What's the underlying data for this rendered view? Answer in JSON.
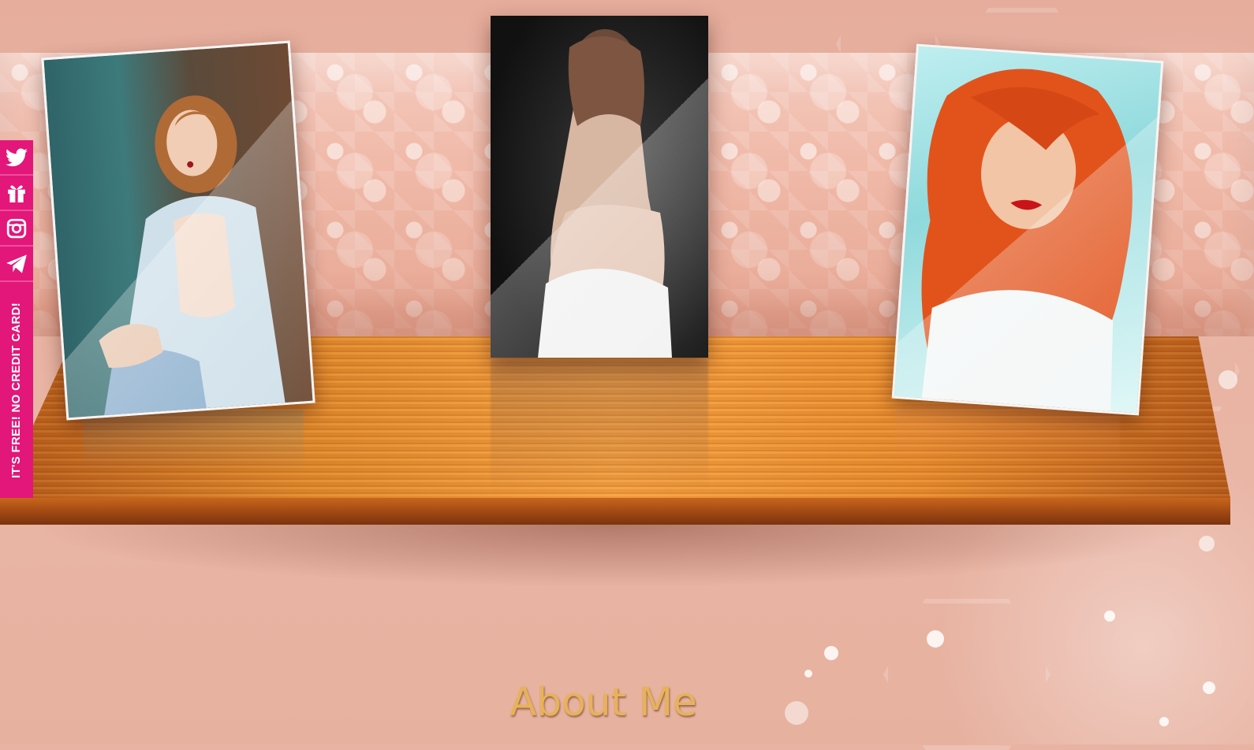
{
  "sidebar": {
    "icons": [
      {
        "name": "twitter-icon"
      },
      {
        "name": "gift-icon"
      },
      {
        "name": "instagram-icon"
      },
      {
        "name": "telegram-icon"
      }
    ],
    "promo_text": "IT'S FREE! NO CREDIT CARD!",
    "color": "#e3167a"
  },
  "gallery": {
    "photos": [
      {
        "name": "photo-left"
      },
      {
        "name": "photo-center"
      },
      {
        "name": "photo-right"
      }
    ]
  },
  "section": {
    "title": "About Me",
    "title_color": "#e8b25a"
  }
}
